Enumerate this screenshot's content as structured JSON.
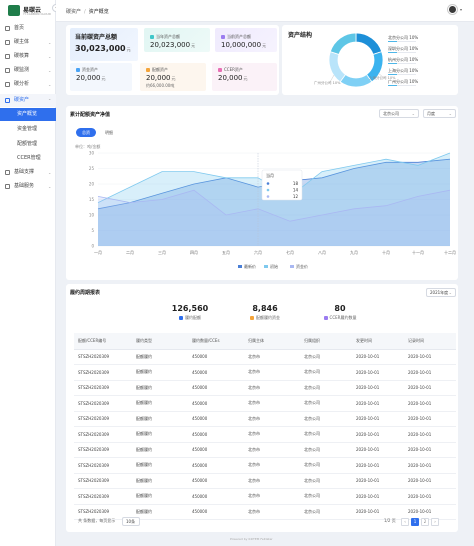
{
  "app": {
    "name": "易碳云",
    "sub": "YI CARBON CLOUD"
  },
  "sidebar": {
    "items": [
      {
        "label": "首页"
      },
      {
        "label": "碳主体"
      },
      {
        "label": "碳核算"
      },
      {
        "label": "碳监测"
      },
      {
        "label": "碳分析"
      },
      {
        "label": "碳资产"
      }
    ],
    "sub_items": [
      {
        "label": "资产概览"
      },
      {
        "label": "资金管理"
      },
      {
        "label": "配额管理"
      },
      {
        "label": "CCER管理"
      }
    ],
    "bottom_items": [
      {
        "label": "基础支撑"
      },
      {
        "label": "基础服务"
      }
    ]
  },
  "breadcrumb": {
    "parent": "碳资产",
    "sep": "/",
    "current": "资产概览"
  },
  "overview": {
    "title": "当前碳资产总额",
    "total": "30,023,000",
    "total_unit": "元",
    "tiles": [
      {
        "label": "当年资产总额",
        "value": "20,023,000",
        "unit": "元",
        "color": "#3ec7c9"
      },
      {
        "label": "当前资产总额",
        "value": "10,000,000",
        "unit": "元",
        "color": "#9b7cf0"
      },
      {
        "label": "资金资产",
        "value": "20,000",
        "unit": "元",
        "color": "#4aa3f5"
      },
      {
        "label": "配额资产",
        "value": "20,000",
        "unit": "元",
        "color": "#f4a43a",
        "sub": "约66,000.00吨"
      },
      {
        "label": "CCER资产",
        "value": "20,000",
        "unit": "元",
        "color": "#e86fb4"
      }
    ]
  },
  "structure": {
    "title": "资产结构",
    "legend": [
      {
        "label": "北京分公司 10%",
        "pct": 10
      },
      {
        "label": "深圳分公司 10%",
        "pct": 10
      },
      {
        "label": "杭州分公司 10%",
        "pct": 10
      },
      {
        "label": "上海分公司 10%",
        "pct": 10
      },
      {
        "label": "广州分公司 10%",
        "pct": 10
      }
    ],
    "callout_left": "广州分公司 10%",
    "callout_right": "上海分公司 10%",
    "colors": [
      "#1d8fd8",
      "#3bb3ef",
      "#7fd0f5",
      "#b9e4fa",
      "#5ec6e6"
    ]
  },
  "trend": {
    "title": "累计配额资产净值",
    "select": "北京公司",
    "period": "月度",
    "tabs": [
      "总资",
      "明细"
    ],
    "unit_label": "单位：吨/金额"
  },
  "chart_data": {
    "type": "area",
    "categories": [
      "一月",
      "二月",
      "三月",
      "四月",
      "五月",
      "六月",
      "七月",
      "八月",
      "九月",
      "十月",
      "十一月",
      "十二月"
    ],
    "ylim": [
      0,
      30
    ],
    "yticks": [
      0,
      5,
      10,
      15,
      20,
      25,
      30
    ],
    "series": [
      {
        "name": "最新价",
        "values": [
          12,
          14,
          17,
          20,
          22,
          19,
          21,
          22,
          25,
          27,
          27,
          28
        ],
        "color": "#4a7fd6"
      },
      {
        "name": "初始",
        "values": [
          14,
          19,
          24,
          24,
          22,
          22,
          16,
          24,
          26,
          28,
          26,
          30
        ],
        "color": "#7fc9ee"
      },
      {
        "name": "资金价",
        "values": [
          16,
          14,
          15,
          18,
          10,
          12,
          8,
          10,
          12,
          13,
          16,
          18
        ],
        "color": "#a9b8f2"
      }
    ],
    "tooltip": {
      "category": "六月",
      "title": "当月",
      "rows": [
        {
          "label": "",
          "value": "18"
        },
        {
          "label": "",
          "value": "14"
        },
        {
          "label": "",
          "value": "12"
        }
      ]
    },
    "legend_position": "bottom"
  },
  "report": {
    "title": "履约周期报表",
    "year": "2021年度",
    "stats": [
      {
        "value": "126,560",
        "label": "履约配额",
        "color": "#2f6fed"
      },
      {
        "value": "8,846",
        "label": "配额履约资金",
        "color": "#f4a43a"
      },
      {
        "value": "80",
        "label": "CCER履约数量",
        "color": "#9b7cf0"
      }
    ],
    "columns": [
      "配额/CCER编号",
      "履约类型",
      "履约数量/CCEs",
      "归属主体",
      "归属组织",
      "发更时间",
      "记录时间"
    ],
    "rows": [
      [
        "STSZH2020309",
        "配额履约",
        "450000",
        "北京市",
        "北京公司",
        "2020-10-01",
        "2020-10-01"
      ],
      [
        "STSZH2020309",
        "配额履约",
        "450000",
        "北京市",
        "北京公司",
        "2020-10-01",
        "2020-10-01"
      ],
      [
        "STSZH2020309",
        "配额履约",
        "450000",
        "北京市",
        "北京公司",
        "2020-10-01",
        "2020-10-01"
      ],
      [
        "STSZH2020309",
        "配额履约",
        "450000",
        "北京市",
        "北京公司",
        "2020-10-01",
        "2020-10-01"
      ],
      [
        "STSZH2020309",
        "配额履约",
        "450000",
        "北京市",
        "北京公司",
        "2020-10-01",
        "2020-10-01"
      ],
      [
        "STSZH2020309",
        "配额履约",
        "450000",
        "北京市",
        "北京公司",
        "2020-10-01",
        "2020-10-01"
      ],
      [
        "STSZH2020309",
        "配额履约",
        "450000",
        "北京市",
        "北京公司",
        "2020-10-01",
        "2020-10-01"
      ],
      [
        "STSZH2020309",
        "配额履约",
        "450000",
        "北京市",
        "北京公司",
        "2020-10-01",
        "2020-10-01"
      ],
      [
        "STSZH2020309",
        "配额履约",
        "450000",
        "北京市",
        "北京公司",
        "2020-10-01",
        "2020-10-01"
      ],
      [
        "STSZH2020309",
        "配额履约",
        "450000",
        "北京市",
        "北京公司",
        "2020-10-01",
        "2020-10-01"
      ],
      [
        "STSZH2020309",
        "配额履约",
        "450000",
        "北京市",
        "北京公司",
        "2020-10-01",
        "2020-10-01"
      ]
    ],
    "pager": {
      "total": "共 条数据",
      "per_page": "每页显示",
      "page_size": "10条",
      "pages": "1/2 页",
      "current": "1",
      "next": "2"
    }
  },
  "footer": "Powered by 04ITEM Feitlater"
}
